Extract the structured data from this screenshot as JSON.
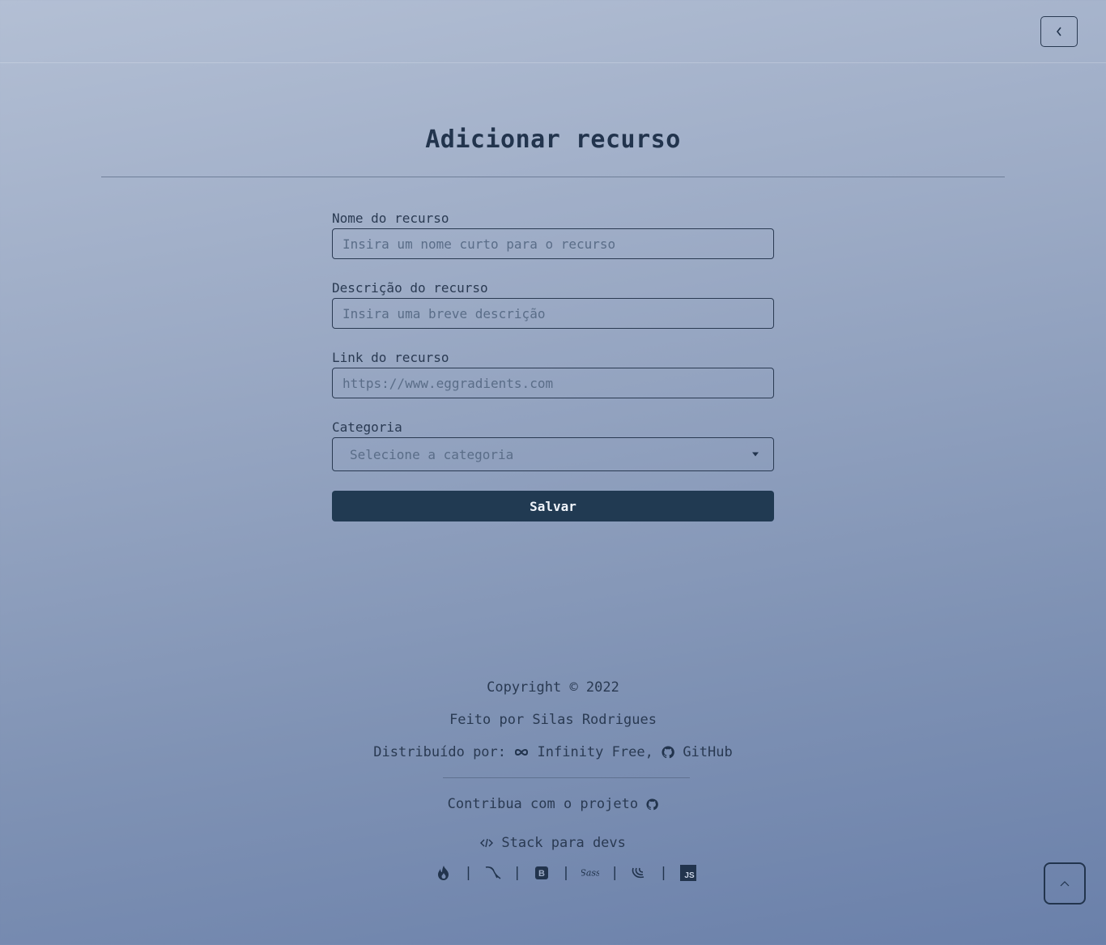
{
  "header": {
    "back_icon": "chevron-left-icon"
  },
  "page": {
    "title": "Adicionar recurso"
  },
  "form": {
    "name": {
      "label": "Nome do recurso",
      "placeholder": "Insira um nome curto para o recurso"
    },
    "description": {
      "label": "Descrição do recurso",
      "placeholder": "Insira uma breve descrição"
    },
    "link": {
      "label": "Link do recurso",
      "placeholder": "https://www.eggradients.com"
    },
    "category": {
      "label": "Categoria",
      "selected": "Selecione a categoria"
    },
    "save_label": "Salvar"
  },
  "footer": {
    "copyright": "Copyright © 2022",
    "made_by": "Feito por Silas Rodrigues",
    "distributed_prefix": "Distribuído por:",
    "distributor_1": "Infinity Free,",
    "distributor_2": "GitHub",
    "contribute": "Contribua com o projeto",
    "stack_title": "Stack para devs",
    "stack_icons": [
      "fire-icon",
      "mysql-icon",
      "bootstrap-icon",
      "sass-icon",
      "jquery-icon",
      "javascript-icon"
    ],
    "js_label": "JS"
  },
  "colors": {
    "primary": "#213a52",
    "text": "#2a3a52"
  }
}
